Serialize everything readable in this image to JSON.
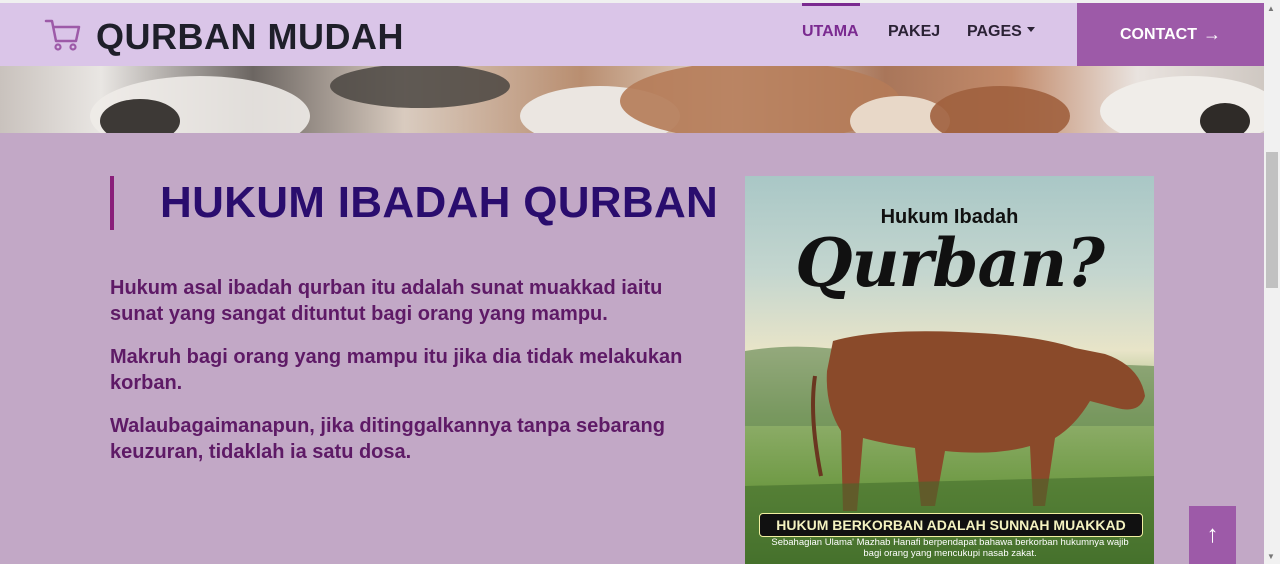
{
  "brand": {
    "name": "QURBAN MUDAH",
    "icon": "shopping-cart-icon",
    "color": "#9d5aa8"
  },
  "nav": {
    "items": [
      {
        "label": "UTAMA",
        "active": true
      },
      {
        "label": "PAKEJ"
      },
      {
        "label": "PAGES",
        "has_dropdown": true
      }
    ],
    "contact_label": "CONTACT",
    "contact_icon": "arrow-right-icon"
  },
  "section": {
    "heading": "HUKUM IBADAH QURBAN",
    "paragraphs": [
      "Hukum asal ibadah qurban itu adalah sunat muakkad iaitu sunat yang sangat dituntut bagi orang yang mampu.",
      "Makruh bagi orang yang mampu itu jika dia tidak melakukan korban.",
      "Walaubagaimanapun, jika ditinggalkannya tanpa sebarang keuzuran, tidaklah ia satu dosa."
    ]
  },
  "poster": {
    "title_line1": "Hukum Ibadah",
    "title_line2": "Qurban?",
    "banner": "HUKUM BERKORBAN ADALAH SUNNAH MUAKKAD",
    "caption": "Sebahagian Ulama' Mazhab Hanafi berpendapat bahawa berkorban hukumnya wajib bagi orang yang mencukupi nasab zakat."
  },
  "scroll_top_icon": "arrow-up-icon",
  "colors": {
    "accent": "#9d5aa8",
    "navbar": "#dac5e8",
    "background": "#c2a8c6",
    "heading": "#2a0d6e",
    "text": "#5e1a66"
  }
}
